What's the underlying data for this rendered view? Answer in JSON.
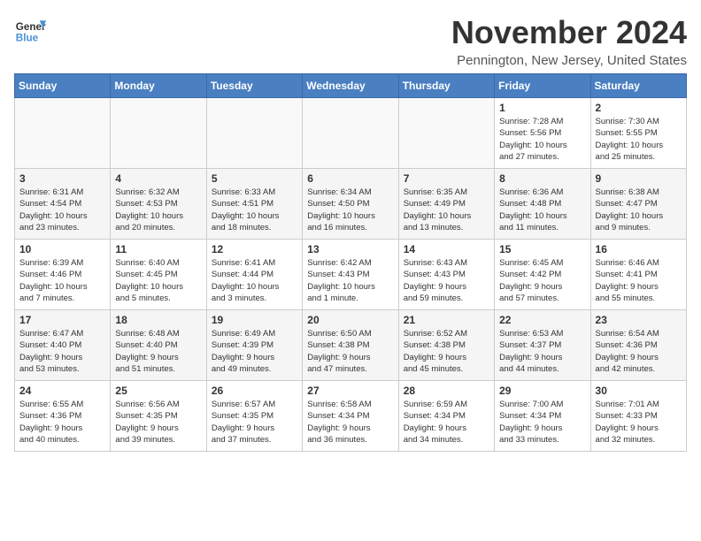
{
  "logo": {
    "line1": "General",
    "line2": "Blue"
  },
  "title": "November 2024",
  "location": "Pennington, New Jersey, United States",
  "weekdays": [
    "Sunday",
    "Monday",
    "Tuesday",
    "Wednesday",
    "Thursday",
    "Friday",
    "Saturday"
  ],
  "weeks": [
    [
      {
        "day": "",
        "content": ""
      },
      {
        "day": "",
        "content": ""
      },
      {
        "day": "",
        "content": ""
      },
      {
        "day": "",
        "content": ""
      },
      {
        "day": "",
        "content": ""
      },
      {
        "day": "1",
        "content": "Sunrise: 7:28 AM\nSunset: 5:56 PM\nDaylight: 10 hours\nand 27 minutes."
      },
      {
        "day": "2",
        "content": "Sunrise: 7:30 AM\nSunset: 5:55 PM\nDaylight: 10 hours\nand 25 minutes."
      }
    ],
    [
      {
        "day": "3",
        "content": "Sunrise: 6:31 AM\nSunset: 4:54 PM\nDaylight: 10 hours\nand 23 minutes."
      },
      {
        "day": "4",
        "content": "Sunrise: 6:32 AM\nSunset: 4:53 PM\nDaylight: 10 hours\nand 20 minutes."
      },
      {
        "day": "5",
        "content": "Sunrise: 6:33 AM\nSunset: 4:51 PM\nDaylight: 10 hours\nand 18 minutes."
      },
      {
        "day": "6",
        "content": "Sunrise: 6:34 AM\nSunset: 4:50 PM\nDaylight: 10 hours\nand 16 minutes."
      },
      {
        "day": "7",
        "content": "Sunrise: 6:35 AM\nSunset: 4:49 PM\nDaylight: 10 hours\nand 13 minutes."
      },
      {
        "day": "8",
        "content": "Sunrise: 6:36 AM\nSunset: 4:48 PM\nDaylight: 10 hours\nand 11 minutes."
      },
      {
        "day": "9",
        "content": "Sunrise: 6:38 AM\nSunset: 4:47 PM\nDaylight: 10 hours\nand 9 minutes."
      }
    ],
    [
      {
        "day": "10",
        "content": "Sunrise: 6:39 AM\nSunset: 4:46 PM\nDaylight: 10 hours\nand 7 minutes."
      },
      {
        "day": "11",
        "content": "Sunrise: 6:40 AM\nSunset: 4:45 PM\nDaylight: 10 hours\nand 5 minutes."
      },
      {
        "day": "12",
        "content": "Sunrise: 6:41 AM\nSunset: 4:44 PM\nDaylight: 10 hours\nand 3 minutes."
      },
      {
        "day": "13",
        "content": "Sunrise: 6:42 AM\nSunset: 4:43 PM\nDaylight: 10 hours\nand 1 minute."
      },
      {
        "day": "14",
        "content": "Sunrise: 6:43 AM\nSunset: 4:43 PM\nDaylight: 9 hours\nand 59 minutes."
      },
      {
        "day": "15",
        "content": "Sunrise: 6:45 AM\nSunset: 4:42 PM\nDaylight: 9 hours\nand 57 minutes."
      },
      {
        "day": "16",
        "content": "Sunrise: 6:46 AM\nSunset: 4:41 PM\nDaylight: 9 hours\nand 55 minutes."
      }
    ],
    [
      {
        "day": "17",
        "content": "Sunrise: 6:47 AM\nSunset: 4:40 PM\nDaylight: 9 hours\nand 53 minutes."
      },
      {
        "day": "18",
        "content": "Sunrise: 6:48 AM\nSunset: 4:40 PM\nDaylight: 9 hours\nand 51 minutes."
      },
      {
        "day": "19",
        "content": "Sunrise: 6:49 AM\nSunset: 4:39 PM\nDaylight: 9 hours\nand 49 minutes."
      },
      {
        "day": "20",
        "content": "Sunrise: 6:50 AM\nSunset: 4:38 PM\nDaylight: 9 hours\nand 47 minutes."
      },
      {
        "day": "21",
        "content": "Sunrise: 6:52 AM\nSunset: 4:38 PM\nDaylight: 9 hours\nand 45 minutes."
      },
      {
        "day": "22",
        "content": "Sunrise: 6:53 AM\nSunset: 4:37 PM\nDaylight: 9 hours\nand 44 minutes."
      },
      {
        "day": "23",
        "content": "Sunrise: 6:54 AM\nSunset: 4:36 PM\nDaylight: 9 hours\nand 42 minutes."
      }
    ],
    [
      {
        "day": "24",
        "content": "Sunrise: 6:55 AM\nSunset: 4:36 PM\nDaylight: 9 hours\nand 40 minutes."
      },
      {
        "day": "25",
        "content": "Sunrise: 6:56 AM\nSunset: 4:35 PM\nDaylight: 9 hours\nand 39 minutes."
      },
      {
        "day": "26",
        "content": "Sunrise: 6:57 AM\nSunset: 4:35 PM\nDaylight: 9 hours\nand 37 minutes."
      },
      {
        "day": "27",
        "content": "Sunrise: 6:58 AM\nSunset: 4:34 PM\nDaylight: 9 hours\nand 36 minutes."
      },
      {
        "day": "28",
        "content": "Sunrise: 6:59 AM\nSunset: 4:34 PM\nDaylight: 9 hours\nand 34 minutes."
      },
      {
        "day": "29",
        "content": "Sunrise: 7:00 AM\nSunset: 4:34 PM\nDaylight: 9 hours\nand 33 minutes."
      },
      {
        "day": "30",
        "content": "Sunrise: 7:01 AM\nSunset: 4:33 PM\nDaylight: 9 hours\nand 32 minutes."
      }
    ]
  ]
}
